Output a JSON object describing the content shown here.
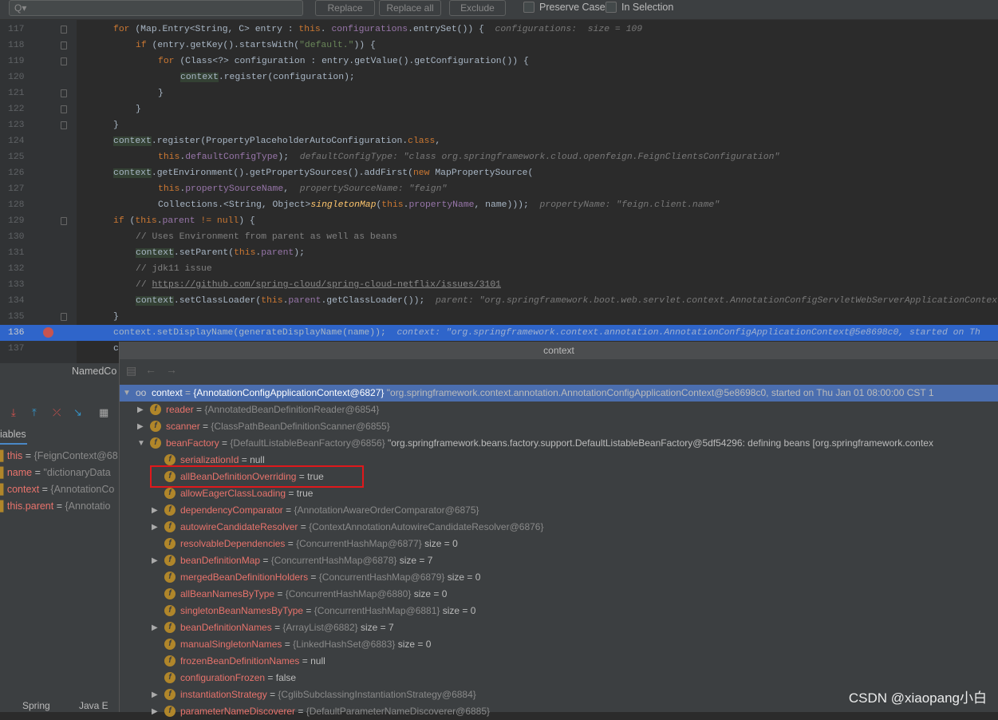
{
  "search": {
    "placeholder": "Q▾",
    "replace": "Replace",
    "replace_all": "Replace all",
    "exclude": "Exclude",
    "preserve_case": "Preserve Case",
    "in_selection": "In Selection"
  },
  "editor": {
    "current_line": "136",
    "lines": [
      {
        "n": "117",
        "fold": true,
        "i": 0,
        "s": [
          [
            "kw",
            "for "
          ],
          [
            "",
            "(Map.Entry<String, C> entry : "
          ],
          [
            "kw",
            "this"
          ],
          [
            "",
            ". "
          ],
          [
            "fd",
            "configurations"
          ],
          [
            "",
            ".entrySet()) {  "
          ],
          [
            "hint",
            "configurations:  size = 109"
          ]
        ]
      },
      {
        "n": "118",
        "fold": true,
        "i": 1,
        "s": [
          [
            "kw",
            "if "
          ],
          [
            "",
            "(entry.getKey().startsWith("
          ],
          [
            "str",
            "\"default.\""
          ],
          [
            "",
            ")) {"
          ]
        ]
      },
      {
        "n": "119",
        "fold": true,
        "i": 2,
        "s": [
          [
            "kw",
            "for "
          ],
          [
            "",
            "(Class<?> configuration : entry.getValue().getConfiguration()) {"
          ]
        ]
      },
      {
        "n": "120",
        "i": 3,
        "s": [
          [
            "ctx",
            "context"
          ],
          [
            "",
            ".register(configuration);"
          ]
        ]
      },
      {
        "n": "121",
        "fold": true,
        "i": 2,
        "s": [
          [
            "",
            "}"
          ]
        ]
      },
      {
        "n": "122",
        "fold": true,
        "i": 1,
        "s": [
          [
            "",
            "}"
          ]
        ]
      },
      {
        "n": "123",
        "fold": true,
        "i": 0,
        "s": [
          [
            "",
            "}"
          ]
        ]
      },
      {
        "n": "124",
        "i": 0,
        "s": [
          [
            "ctx",
            "context"
          ],
          [
            "",
            ".register(PropertyPlaceholderAutoConfiguration."
          ],
          [
            "kw",
            "class"
          ],
          [
            "",
            ","
          ]
        ]
      },
      {
        "n": "125",
        "i": 2,
        "s": [
          [
            "kw",
            "this"
          ],
          [
            "",
            "."
          ],
          [
            "fd",
            "defaultConfigType"
          ],
          [
            "",
            ");  "
          ],
          [
            "hint",
            "defaultConfigType: \"class org.springframework.cloud.openfeign.FeignClientsConfiguration\""
          ]
        ]
      },
      {
        "n": "126",
        "i": 0,
        "s": [
          [
            "ctx",
            "context"
          ],
          [
            "",
            ".getEnvironment().getPropertySources().addFirst("
          ],
          [
            "kw",
            "new "
          ],
          [
            "",
            "MapPropertySource("
          ]
        ]
      },
      {
        "n": "127",
        "i": 2,
        "s": [
          [
            "kw",
            "this"
          ],
          [
            "",
            "."
          ],
          [
            "fd",
            "propertySourceName"
          ],
          [
            "",
            ",  "
          ],
          [
            "hint",
            "propertySourceName: \"feign\""
          ]
        ]
      },
      {
        "n": "128",
        "i": 2,
        "s": [
          [
            "",
            "Collections.<String, Object>"
          ],
          [
            "fn",
            "singletonMap"
          ],
          [
            "",
            "("
          ],
          [
            "kw",
            "this"
          ],
          [
            "",
            "."
          ],
          [
            "fd",
            "propertyName"
          ],
          [
            "",
            ", name)));  "
          ],
          [
            "hint",
            "propertyName: \"feign.client.name\""
          ]
        ]
      },
      {
        "n": "129",
        "fold": true,
        "i": 0,
        "s": [
          [
            "kw",
            "if "
          ],
          [
            "",
            "("
          ],
          [
            "kw",
            "this"
          ],
          [
            "",
            "."
          ],
          [
            "fd",
            "parent"
          ],
          [
            "kw",
            " != null"
          ],
          [
            "",
            ") {"
          ]
        ]
      },
      {
        "n": "130",
        "i": 1,
        "s": [
          [
            "cm",
            "// Uses Environment from parent as well as beans"
          ]
        ]
      },
      {
        "n": "131",
        "i": 1,
        "s": [
          [
            "ctx",
            "context"
          ],
          [
            "",
            ".setParent("
          ],
          [
            "kw",
            "this"
          ],
          [
            "",
            "."
          ],
          [
            "fd",
            "parent"
          ],
          [
            "",
            ");"
          ]
        ]
      },
      {
        "n": "132",
        "i": 1,
        "s": [
          [
            "cm",
            "// jdk11 issue"
          ]
        ]
      },
      {
        "n": "133",
        "i": 1,
        "s": [
          [
            "cm",
            "// "
          ],
          [
            "lnk",
            "https://github.com/spring-cloud/spring-cloud-netflix/issues/3101"
          ]
        ]
      },
      {
        "n": "134",
        "i": 1,
        "s": [
          [
            "ctx",
            "context"
          ],
          [
            "",
            ".setClassLoader("
          ],
          [
            "kw",
            "this"
          ],
          [
            "",
            "."
          ],
          [
            "fd",
            "parent"
          ],
          [
            "",
            ".getClassLoader());  "
          ],
          [
            "hint",
            "parent: \"org.springframework.boot.web.servlet.context.AnnotationConfigServletWebServerApplicationContext"
          ]
        ]
      },
      {
        "n": "135",
        "fold": true,
        "i": 0,
        "s": [
          [
            "",
            "}"
          ]
        ]
      },
      {
        "n": "136",
        "i": 0,
        "s": [
          [
            "",
            "context.setDisplayName(generateDisplayName(name));  "
          ],
          [
            "hint",
            "context: \"org.springframework.context.annotation.AnnotationConfigApplicationContext@5e8698c0, started on Th"
          ]
        ]
      },
      {
        "n": "137",
        "i": 0,
        "s": [
          [
            "",
            "c"
          ]
        ]
      }
    ]
  },
  "left": {
    "tab": "NamedCo",
    "vars_tab": "iables",
    "vars": [
      {
        "name": "this",
        "value": "{FeignContext@68"
      },
      {
        "name": "name",
        "value": "\"dictionaryData"
      },
      {
        "name": "context",
        "value": "{AnnotationCo"
      },
      {
        "name": "this.parent",
        "value": "{Annotatio"
      }
    ],
    "bottom_tabs": [
      "Spring",
      "Java E"
    ]
  },
  "popup": {
    "title": "context",
    "rows": [
      {
        "d": 0,
        "exp": "open",
        "icon": "oo",
        "name": "context",
        "value": "{AnnotationConfigApplicationContext@6827}",
        "extra": " \"org.springframework.context.annotation.AnnotationConfigApplicationContext@5e8698c0, started on Thu Jan 01 08:00:00 CST 1",
        "sel": true
      },
      {
        "d": 1,
        "exp": "closed",
        "name": "reader",
        "value": "{AnnotatedBeanDefinitionReader@6854}"
      },
      {
        "d": 1,
        "exp": "closed",
        "name": "scanner",
        "value": "{ClassPathBeanDefinitionScanner@6855}"
      },
      {
        "d": 1,
        "exp": "open",
        "name": "beanFactory",
        "value": "{DefaultListableBeanFactory@6856}",
        "extra": " \"org.springframework.beans.factory.support.DefaultListableBeanFactory@5df54296: defining beans [org.springframework.contex"
      },
      {
        "d": 2,
        "name": "serializationId",
        "value": "null",
        "plain": true
      },
      {
        "d": 2,
        "name": "allBeanDefinitionOverriding",
        "value": "true",
        "plain": true
      },
      {
        "d": 2,
        "name": "allowEagerClassLoading",
        "value": "true",
        "plain": true
      },
      {
        "d": 2,
        "exp": "closed",
        "name": "dependencyComparator",
        "value": "{AnnotationAwareOrderComparator@6875}"
      },
      {
        "d": 2,
        "exp": "closed",
        "name": "autowireCandidateResolver",
        "value": "{ContextAnnotationAutowireCandidateResolver@6876}"
      },
      {
        "d": 2,
        "name": "resolvableDependencies",
        "value": "{ConcurrentHashMap@6877}",
        "extra": "  size = 0"
      },
      {
        "d": 2,
        "exp": "closed",
        "name": "beanDefinitionMap",
        "value": "{ConcurrentHashMap@6878}",
        "extra": "  size = 7"
      },
      {
        "d": 2,
        "name": "mergedBeanDefinitionHolders",
        "value": "{ConcurrentHashMap@6879}",
        "extra": "  size = 0"
      },
      {
        "d": 2,
        "name": "allBeanNamesByType",
        "value": "{ConcurrentHashMap@6880}",
        "extra": "  size = 0"
      },
      {
        "d": 2,
        "name": "singletonBeanNamesByType",
        "value": "{ConcurrentHashMap@6881}",
        "extra": "  size = 0"
      },
      {
        "d": 2,
        "exp": "closed",
        "name": "beanDefinitionNames",
        "value": "{ArrayList@6882}",
        "extra": "  size = 7"
      },
      {
        "d": 2,
        "name": "manualSingletonNames",
        "value": "{LinkedHashSet@6883}",
        "extra": "  size = 0"
      },
      {
        "d": 2,
        "name": "frozenBeanDefinitionNames",
        "value": "null",
        "plain": true
      },
      {
        "d": 2,
        "name": "configurationFrozen",
        "value": "false",
        "plain": true
      },
      {
        "d": 2,
        "exp": "closed",
        "name": "instantiationStrategy",
        "value": "{CglibSubclassingInstantiationStrategy@6884}"
      },
      {
        "d": 2,
        "exp": "closed",
        "name": "parameterNameDiscoverer",
        "value": "{DefaultParameterNameDiscoverer@6885}"
      }
    ]
  },
  "watermark": "CSDN @xiaopang小白"
}
